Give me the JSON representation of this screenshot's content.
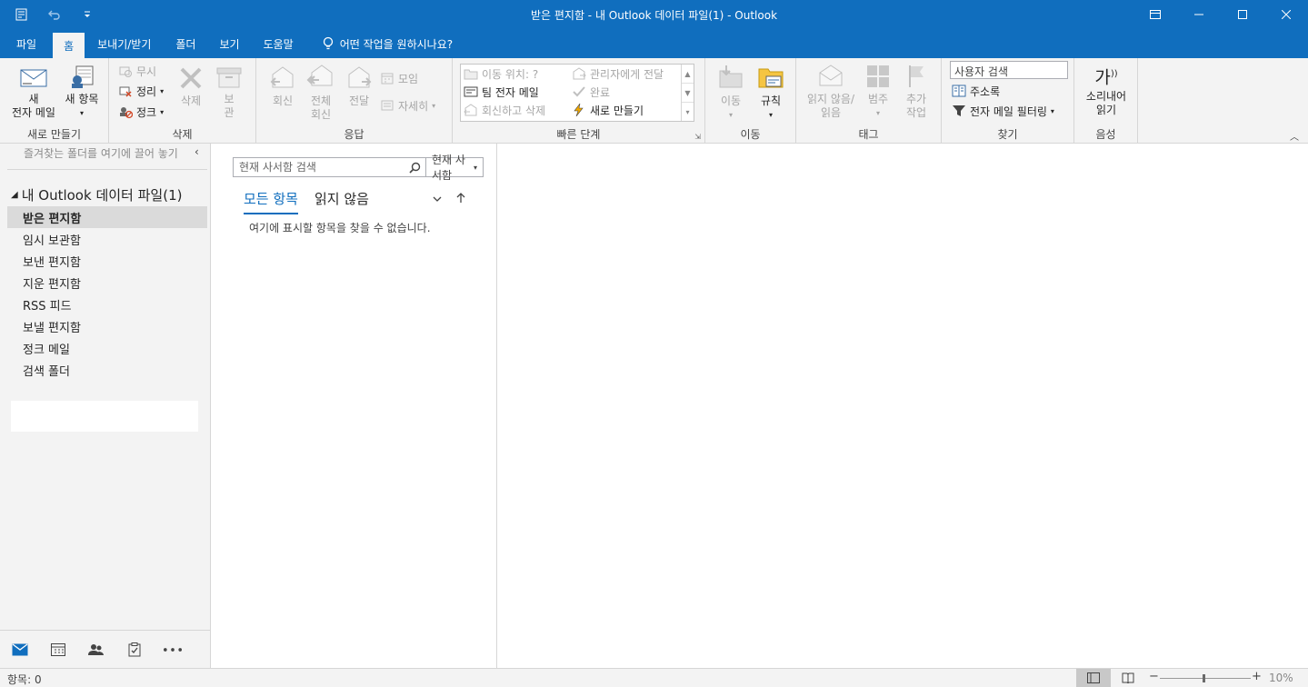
{
  "window": {
    "title": "받은 편지함 - 내 Outlook 데이터 파일(1)  -  Outlook"
  },
  "tabs": [
    "파일",
    "홈",
    "보내기/받기",
    "폴더",
    "보기",
    "도움말"
  ],
  "tell_me": "어떤 작업을 원하시나요?",
  "ribbon": {
    "new": {
      "label": "새로 만들기",
      "new_email": [
        "새",
        "전자 메일"
      ],
      "new_items": "새 항목"
    },
    "delete": {
      "label": "삭제",
      "ignore": "무시",
      "clean_up": "정리",
      "junk": "정크",
      "delete_btn": "삭제",
      "archive": [
        "보",
        "관"
      ]
    },
    "respond": {
      "label": "응답",
      "reply": "회신",
      "reply_all": [
        "전체",
        "회신"
      ],
      "forward": "전달",
      "meeting": "모임",
      "more": "자세히"
    },
    "quick_steps": {
      "label": "빠른 단계",
      "move_to": "이동 위치: ?",
      "to_manager": "관리자에게 전달",
      "team_email": "팀 전자 메일",
      "done": "완료",
      "reply_delete": "회신하고 삭제",
      "create_new": "새로 만들기"
    },
    "move": {
      "label": "이동",
      "move_btn": "이동",
      "rules": "규칙"
    },
    "tags": {
      "label": "태그",
      "unread_read": [
        "읽지 않음/",
        "읽음"
      ],
      "categorize": "범주",
      "follow_up": [
        "추가",
        "작업"
      ]
    },
    "find": {
      "label": "찾기",
      "search_people": "사용자 검색",
      "address_book": "주소록",
      "filter_email": "전자 메일 필터링"
    },
    "speech": {
      "label": "음성",
      "read_aloud": [
        "소리내어",
        "읽기"
      ],
      "glyph": "가"
    }
  },
  "nav": {
    "favorites_hint": "즐겨찾는 폴더를 여기에 끌어 놓기",
    "root": "내 Outlook 데이터 파일(1)",
    "folders": [
      "받은 편지함",
      "임시 보관함",
      "보낸 편지함",
      "지운 편지함",
      "RSS 피드",
      "보낼 편지함",
      "정크 메일",
      "검색 폴더"
    ]
  },
  "list": {
    "search_placeholder": "현재 사서함 검색",
    "scope": "현재 사서함",
    "filter_all": "모든 항목",
    "filter_unread": "읽지 않음",
    "empty": "여기에 표시할 항목을 찾을 수 없습니다."
  },
  "status": {
    "items": "항목: 0",
    "zoom": "10%"
  },
  "colors": {
    "accent": "#106ebe",
    "ribbon_bg": "#f3f3f3",
    "disabled": "#a6a6a6"
  }
}
